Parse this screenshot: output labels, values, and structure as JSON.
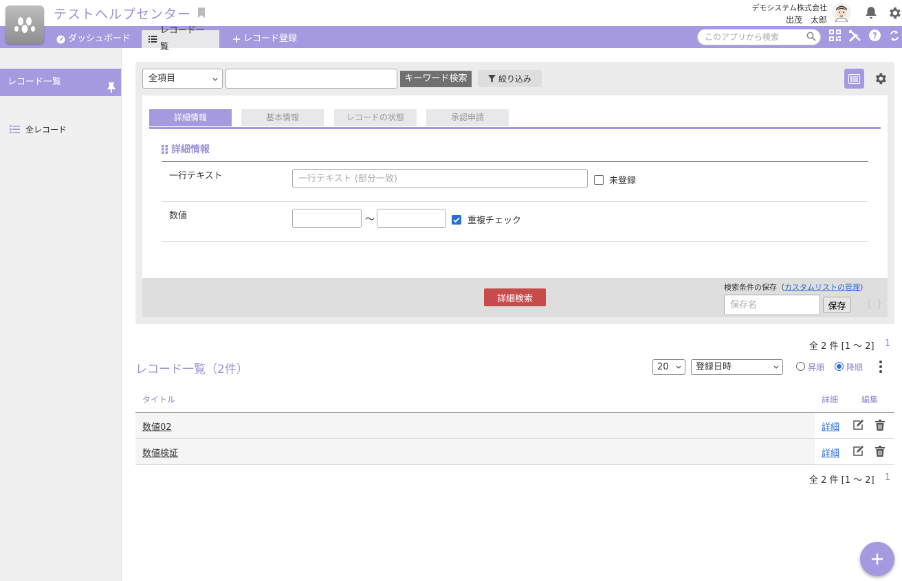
{
  "header": {
    "app_title": "テストヘルプセンター",
    "company": "デモシステム株式会社",
    "user_name": "出茂　太郎"
  },
  "nav": {
    "dashboard": "ダッシュボード",
    "record_list": "レコード一覧",
    "record_add": "レコード登録",
    "search_placeholder": "このアプリから検索"
  },
  "sidebar": {
    "header": "レコード一覧",
    "items": [
      {
        "label": "全レコード"
      }
    ]
  },
  "search": {
    "field_select": "全項目",
    "keyword_button": "キーワード検索",
    "filter_button": "絞り込み",
    "tabs": [
      {
        "label": "詳細情報",
        "active": true
      },
      {
        "label": "基本情報",
        "active": false
      },
      {
        "label": "レコードの状態",
        "active": false
      },
      {
        "label": "承認申請",
        "active": false
      }
    ],
    "section_title": "詳細情報",
    "fields": {
      "text_label": "一行テキスト",
      "text_placeholder": "一行テキスト (部分一致)",
      "unregistered_label": "未登録",
      "unregistered_checked": false,
      "number_label": "数値",
      "range_sep": "〜",
      "dup_check_label": "重複チェック",
      "dup_check_checked": true
    },
    "detail_search_button": "詳細検索",
    "save_caption_prefix": "検索条件の保存（",
    "save_caption_link": "カスタムリストの管理",
    "save_caption_suffix": "）",
    "save_name_placeholder": "保存名",
    "save_button": "保存",
    "braces": "{ }"
  },
  "list": {
    "pager_text": "全 2 件 [1 〜 2]",
    "pager_page": "1",
    "title": "レコード一覧（2件）",
    "per_page": "20",
    "sort_field": "登録日時",
    "asc_label": "昇順",
    "desc_label": "降順",
    "sort_order": "desc",
    "columns": {
      "title": "タイトル",
      "detail": "詳細",
      "edit": "編集"
    },
    "rows": [
      {
        "title": "数値02",
        "detail": "詳細"
      },
      {
        "title": "数値検証",
        "detail": "詳細"
      }
    ]
  },
  "colors": {
    "accent": "#a59ae0",
    "danger": "#c84b4b",
    "link": "#2a6fd8"
  }
}
